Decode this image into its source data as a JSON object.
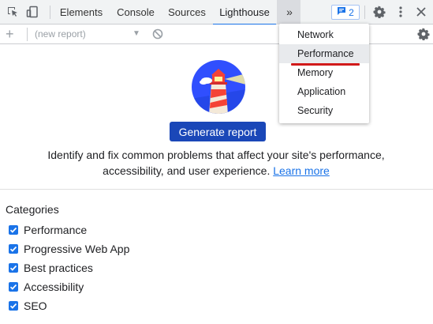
{
  "tabbar": {
    "tabs": [
      {
        "label": "Elements",
        "active": false
      },
      {
        "label": "Console",
        "active": false
      },
      {
        "label": "Sources",
        "active": false
      },
      {
        "label": "Lighthouse",
        "active": true
      }
    ],
    "more_tabs_label": "»",
    "issues_count": "2"
  },
  "toolbar": {
    "report_placeholder": "(new report)"
  },
  "main": {
    "generate_label": "Generate report",
    "description": "Identify and fix common problems that affect your site's performance, accessibility, and user experience.",
    "learn_more": "Learn more",
    "categories_title": "Categories",
    "categories": [
      {
        "label": "Performance",
        "checked": true
      },
      {
        "label": "Progressive Web App",
        "checked": true
      },
      {
        "label": "Best practices",
        "checked": true
      },
      {
        "label": "Accessibility",
        "checked": true
      },
      {
        "label": "SEO",
        "checked": true
      }
    ]
  },
  "dropdown": {
    "items": [
      {
        "label": "Network"
      },
      {
        "label": "Performance",
        "highlighted": true
      },
      {
        "label": "Memory"
      },
      {
        "label": "Application"
      },
      {
        "label": "Security"
      }
    ]
  },
  "colors": {
    "accent": "#1a73e8",
    "button_bg": "#1a47b8",
    "annotation_red": "#d11a1a"
  }
}
